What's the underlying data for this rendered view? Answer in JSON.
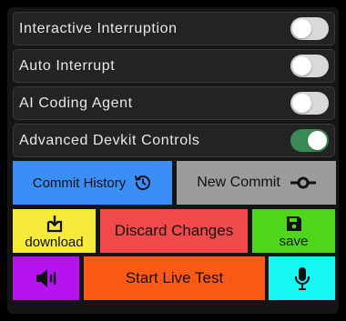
{
  "settings": [
    {
      "label": "Interactive Interruption",
      "on": false
    },
    {
      "label": "Auto Interrupt",
      "on": false
    },
    {
      "label": "AI Coding Agent",
      "on": false
    },
    {
      "label": "Advanced Devkit Controls",
      "on": true
    }
  ],
  "buttons": {
    "commit_history": {
      "label": "Commit History",
      "icon": "history-icon",
      "color": "#3a8ef5"
    },
    "new_commit": {
      "label": "New Commit",
      "icon": "commit-icon",
      "color": "#9c9c9c"
    },
    "download": {
      "label": "download",
      "icon": "download-icon",
      "color": "#f8ea3b"
    },
    "discard_changes": {
      "label": "Discard Changes",
      "icon": "",
      "color": "#f24a4a"
    },
    "save": {
      "label": "save",
      "icon": "save-icon",
      "color": "#4fd61a"
    },
    "speaker": {
      "label": "",
      "icon": "speaker-icon",
      "color": "#b514f0"
    },
    "start_live_test": {
      "label": "Start Live Test",
      "icon": "",
      "color": "#fb5a16"
    },
    "mic": {
      "label": "",
      "icon": "microphone-icon",
      "color": "#16f7f2"
    }
  },
  "colors": {
    "background": "#000000",
    "panel": "#151515",
    "row": "#232323",
    "toggle_off": "#d9d9d9",
    "toggle_on": "#3a8a55"
  }
}
